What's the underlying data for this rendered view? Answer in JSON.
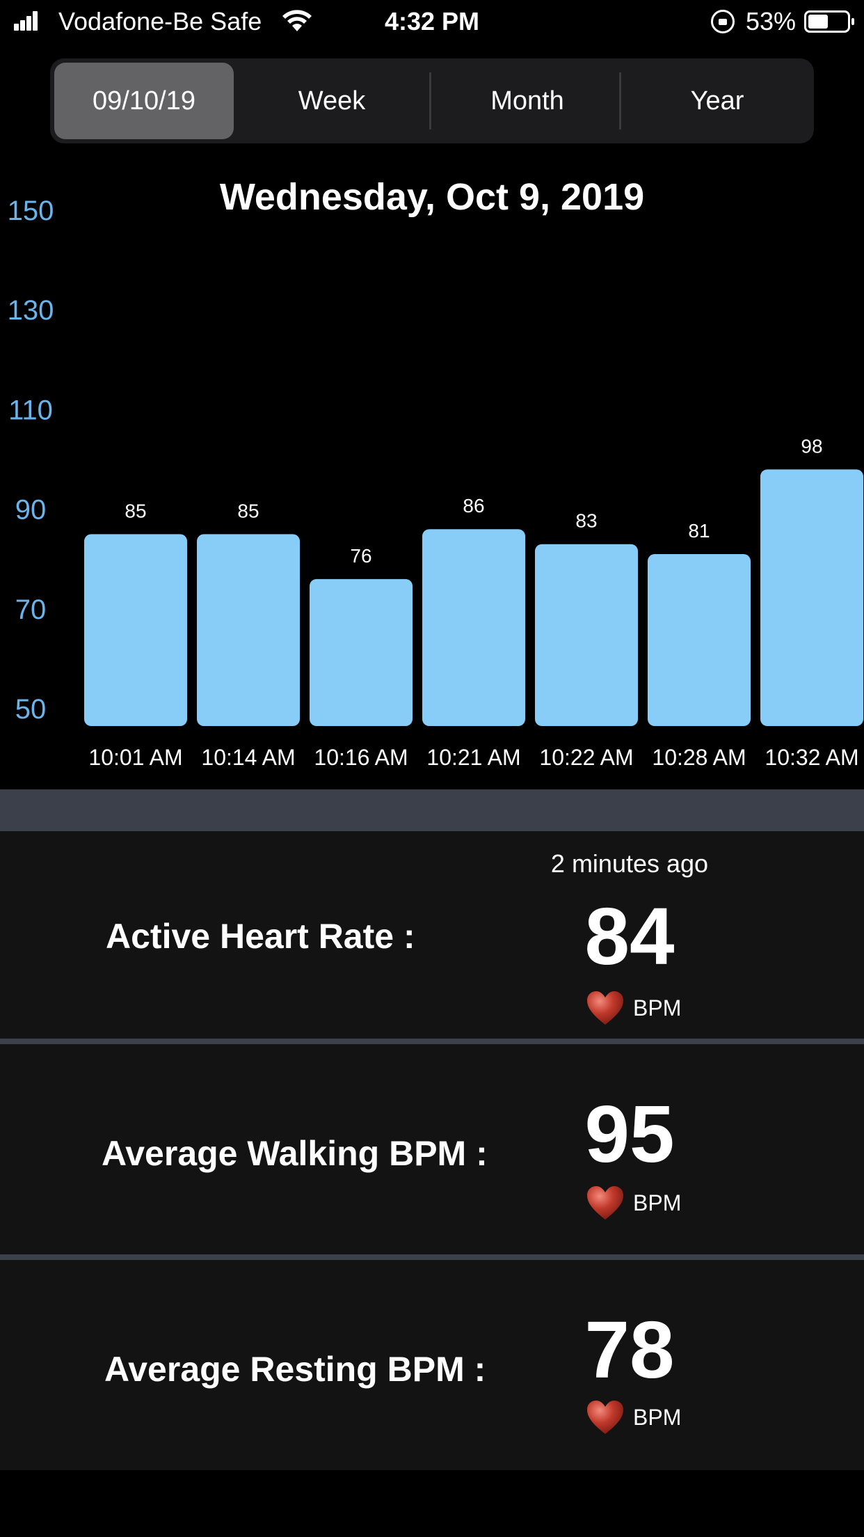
{
  "status_bar": {
    "carrier": "Vodafone-Be Safe",
    "time": "4:32 PM",
    "battery": "53%"
  },
  "segments": [
    {
      "label": "09/10/19",
      "selected": true
    },
    {
      "label": "Week",
      "selected": false
    },
    {
      "label": "Month",
      "selected": false
    },
    {
      "label": "Year",
      "selected": false
    }
  ],
  "chart": {
    "title": "Wednesday, Oct 9, 2019"
  },
  "chart_data": {
    "type": "bar",
    "title": "Wednesday, Oct 9, 2019",
    "categories": [
      "10:01 AM",
      "10:14 AM",
      "10:16 AM",
      "10:21 AM",
      "10:22 AM",
      "10:28 AM",
      "10:32 AM"
    ],
    "values": [
      85,
      85,
      76,
      86,
      83,
      81,
      98
    ],
    "yticks": [
      150,
      130,
      110,
      90,
      70,
      50
    ],
    "ylim": [
      50,
      150
    ],
    "bar_color": "#88cdf8",
    "tick_color": "#6ab4ec",
    "grid": false
  },
  "stats": {
    "active": {
      "label": "Active Heart Rate :",
      "sub": "2 minutes ago",
      "value": "84",
      "unit": "BPM"
    },
    "walking": {
      "label": "Average Walking BPM :",
      "value": "95",
      "unit": "BPM"
    },
    "resting": {
      "label": "Average Resting BPM :",
      "value": "78",
      "unit": "BPM"
    }
  },
  "icons": {
    "heart": "heart-icon"
  },
  "colors": {
    "background": "#000000",
    "card": "#131313",
    "divider": "#3b404a",
    "heart": "#c0392b"
  }
}
